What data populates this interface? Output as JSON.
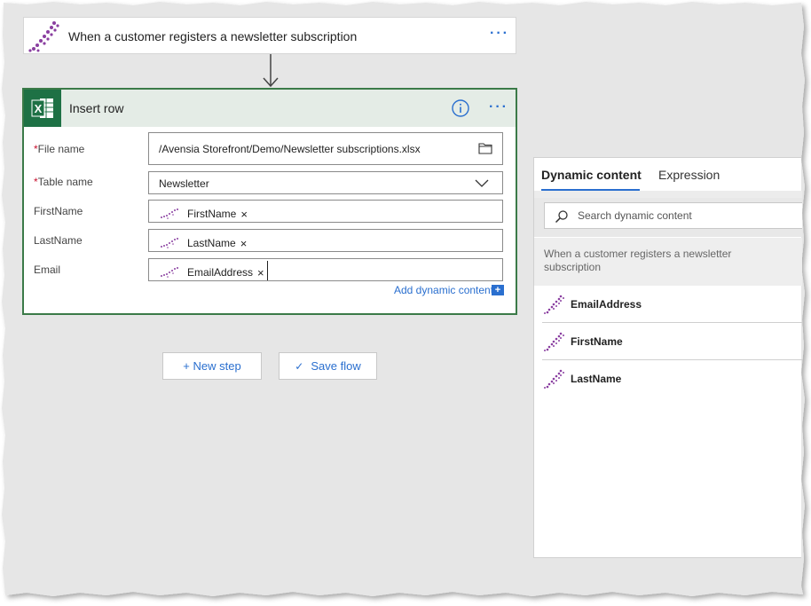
{
  "trigger": {
    "title": "When a customer registers a newsletter subscription",
    "menu": "···"
  },
  "insert_row": {
    "title": "Insert row",
    "menu": "···",
    "fields": {
      "file_name": {
        "label": "File name",
        "required": "*",
        "value": "/Avensia Storefront/Demo/Newsletter subscriptions.xlsx"
      },
      "table_name": {
        "label": "Table name",
        "required": "*",
        "value": "Newsletter"
      },
      "first_name": {
        "label": "FirstName",
        "token": "FirstName",
        "remove": "×"
      },
      "last_name": {
        "label": "LastName",
        "token": "LastName",
        "remove": "×"
      },
      "email": {
        "label": "Email",
        "token": "EmailAddress",
        "remove": "×"
      }
    },
    "add_dynamic": "Add dynamic content",
    "add_dynamic_icon": "+"
  },
  "buttons": {
    "new_step": "+ New step",
    "save_flow": "Save flow",
    "save_icon": "✓"
  },
  "dynamic_panel": {
    "tabs": [
      "Dynamic content",
      "Expression"
    ],
    "search_placeholder": "Search dynamic content",
    "section": "When a customer registers a newsletter subscription",
    "items": [
      "EmailAddress",
      "FirstName",
      "LastName"
    ]
  },
  "colors": {
    "accent": "#2a6fcf",
    "excel_green": "#1e7145",
    "card_border": "#3b7a48",
    "trigger_icon": "#8a3fa0"
  }
}
